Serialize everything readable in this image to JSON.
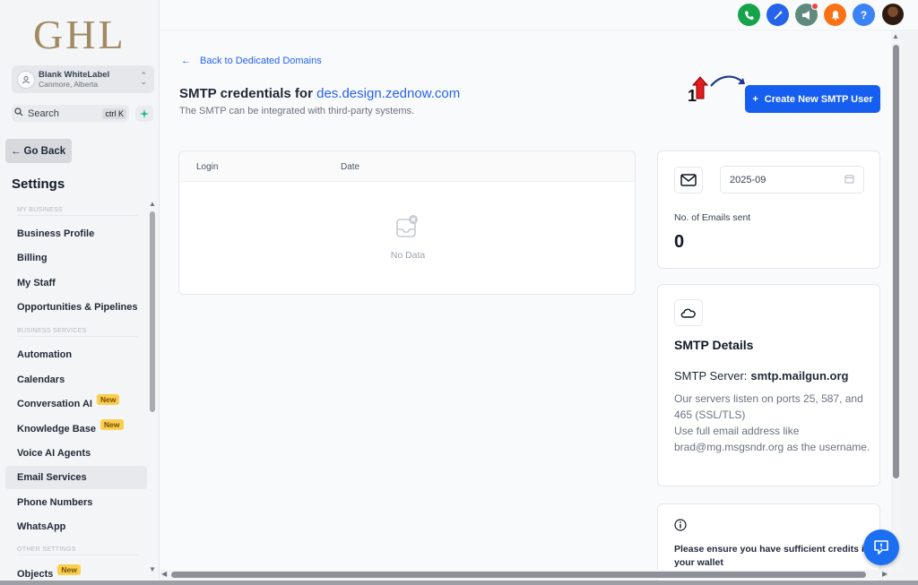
{
  "sidebar": {
    "logo": "GHL",
    "account": {
      "name": "Blank WhiteLabel",
      "location": "Canmore, Alberta"
    },
    "search": {
      "label": "Search",
      "shortcut": "ctrl K"
    },
    "go_back": "Go Back",
    "title": "Settings",
    "sections": {
      "my_business": "MY BUSINESS",
      "business_services": "BUSINESS SERVICES",
      "other_settings": "OTHER SETTINGS"
    },
    "items": [
      {
        "label": "Business Profile"
      },
      {
        "label": "Billing"
      },
      {
        "label": "My Staff"
      },
      {
        "label": "Opportunities & Pipelines"
      },
      {
        "label": "Automation"
      },
      {
        "label": "Calendars"
      },
      {
        "label": "Conversation AI",
        "badge": "New"
      },
      {
        "label": "Knowledge Base",
        "badge": "New"
      },
      {
        "label": "Voice AI Agents"
      },
      {
        "label": "Email Services",
        "active": true
      },
      {
        "label": "Phone Numbers"
      },
      {
        "label": "WhatsApp"
      },
      {
        "label": "Objects",
        "badge": "New"
      }
    ]
  },
  "topbar": {
    "icons": [
      {
        "name": "phone-icon",
        "color": "#16a34a"
      },
      {
        "name": "magic-wand-icon",
        "color": "#2563eb"
      },
      {
        "name": "megaphone-icon",
        "color": "#5f8a7e"
      },
      {
        "name": "bell-icon",
        "color": "#f97316"
      },
      {
        "name": "help-icon",
        "color": "#3b82f6"
      }
    ]
  },
  "main": {
    "back_link": "Back to Dedicated Domains",
    "title": "SMTP credentials for",
    "domain": "des.design.zednow.com",
    "subtitle": "The SMTP can be integrated with third-party systems.",
    "create_button": "Create New SMTP User",
    "annotation_number": "1",
    "table": {
      "columns": [
        "Login",
        "Date"
      ],
      "empty_text": "No Data"
    },
    "stats_card": {
      "date": "2025-09",
      "label": "No. of Emails sent",
      "value": "0"
    },
    "smtp_card": {
      "title": "SMTP Details",
      "server_label": "SMTP Server:",
      "server_value": "smtp.mailgun.org",
      "info": "Our servers listen on ports 25, 587, and 465 (SSL/TLS)\nUse full email address like brad@mg.msgsndr.org as the username."
    },
    "wallet_card": {
      "text": "Please ensure you have sufficient credits in your wallet"
    }
  },
  "colors": {
    "accent": "#155eef",
    "link": "#2563eb",
    "badge": "#f8cf4f"
  }
}
